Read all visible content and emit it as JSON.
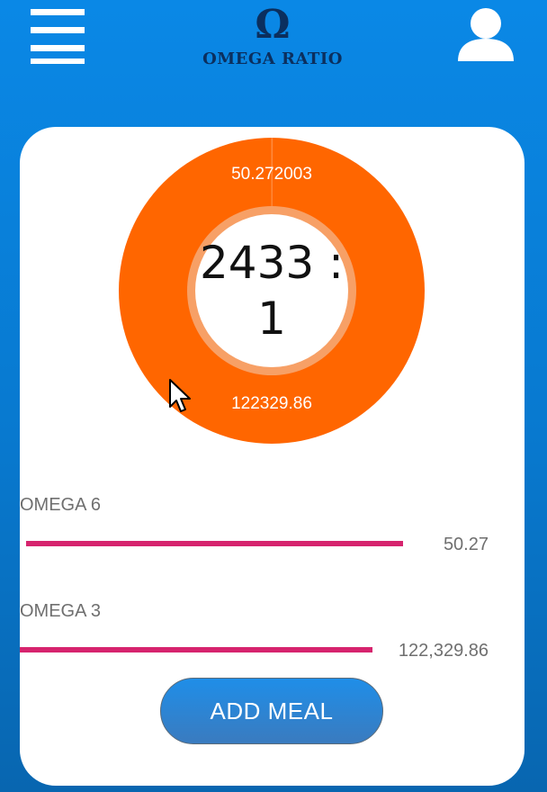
{
  "header": {
    "logo_symbol": "Ω",
    "logo_text": "OMEGA RATIO"
  },
  "donut": {
    "omega6_label": "50.272003",
    "omega3_label": "122329.86",
    "ratio_text": "2433 : 1",
    "omega6_value": 50.272003,
    "omega3_value": 122329.86,
    "colors": {
      "ring": "#ff6600",
      "inner_ring": "#f7a066",
      "center": "#ffffff"
    }
  },
  "bars": [
    {
      "label": "OMEGA 6",
      "value": "50.27",
      "fill_fraction": 0.79,
      "color": "#d6246e"
    },
    {
      "label": "OMEGA 3",
      "value": "122,329.86",
      "fill_fraction": 0.74,
      "color": "#d6246e"
    }
  ],
  "actions": {
    "add_meal_label": "ADD MEAL"
  },
  "icons": {
    "menu": "hamburger-menu-icon",
    "user": "user-profile-icon",
    "cursor": "mouse-pointer-icon"
  }
}
